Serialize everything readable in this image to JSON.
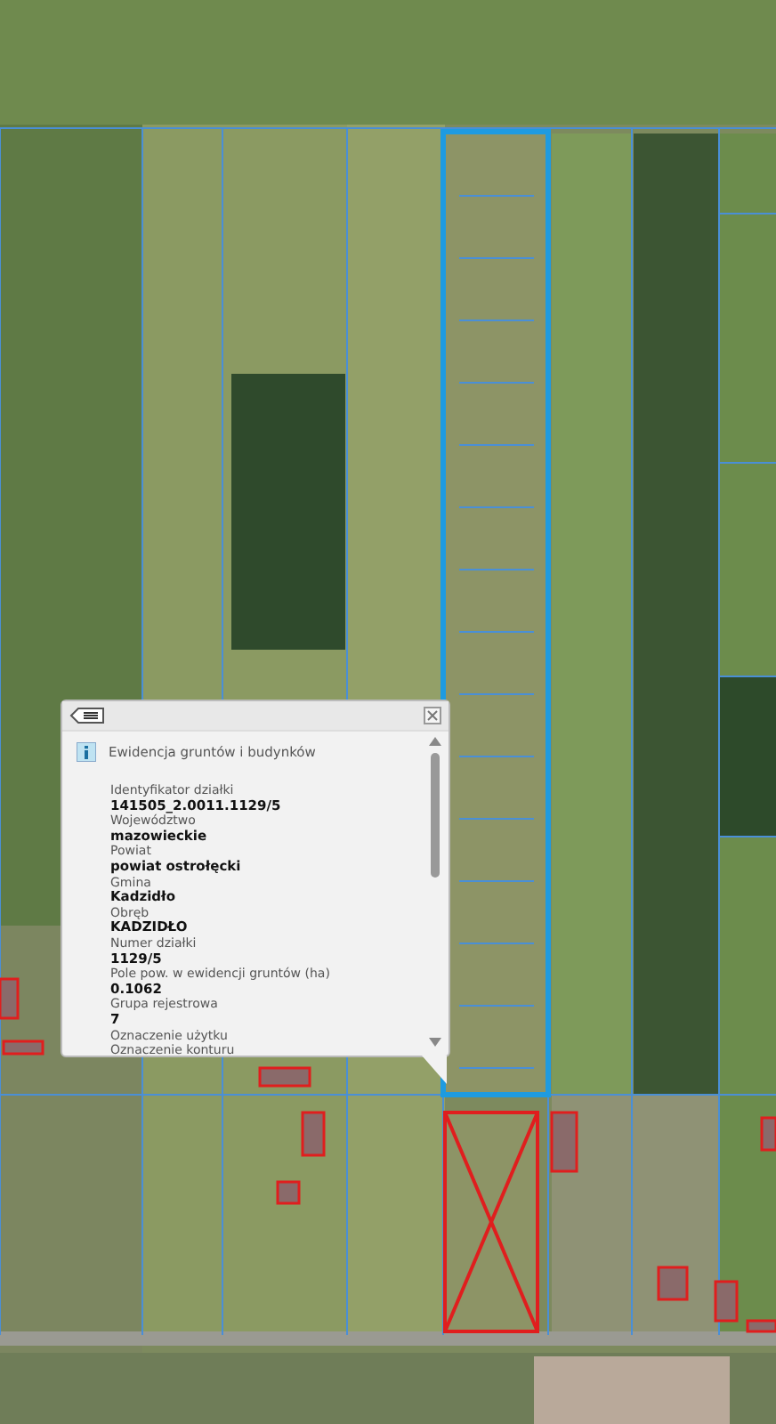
{
  "popup": {
    "title": "Ewidencja gruntów i budynków",
    "fields": [
      {
        "label": "Identyfikator działki",
        "value": "141505_2.0011.1129/5"
      },
      {
        "label": "Województwo",
        "value": "mazowieckie"
      },
      {
        "label": "Powiat",
        "value": "powiat ostrołęcki"
      },
      {
        "label": "Gmina",
        "value": "Kadzidło"
      },
      {
        "label": "Obręb",
        "value": "KADZIDŁO"
      },
      {
        "label": "Numer działki",
        "value": "1129/5"
      },
      {
        "label": "Pole pow. w ewidencji gruntów (ha)",
        "value": "0.1062"
      },
      {
        "label": "Grupa rejestrowa",
        "value": "7"
      },
      {
        "label": "Oznaczenie użytku"
      },
      {
        "label": "Oznaczenie konturu"
      }
    ]
  }
}
